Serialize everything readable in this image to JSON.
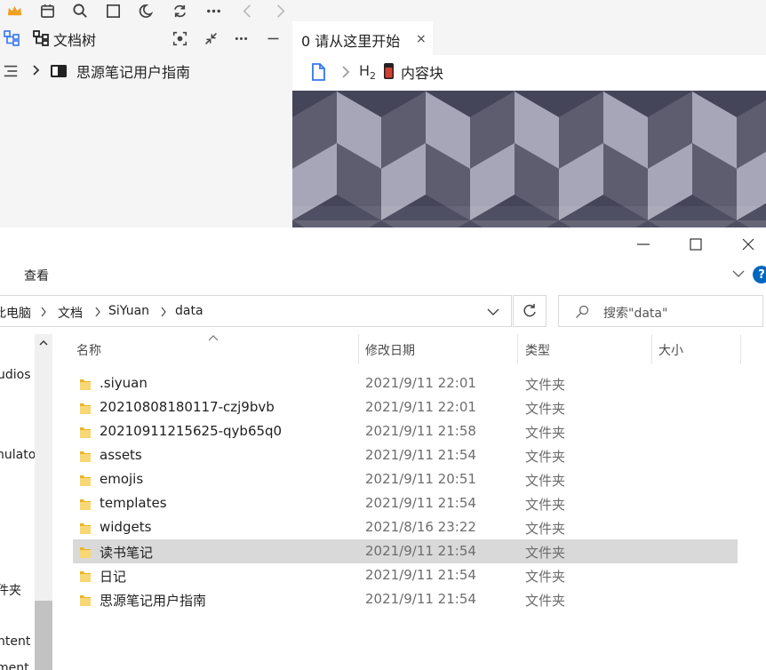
{
  "siyuan": {
    "toolbar_icons": [
      "crown-icon",
      "calendar-icon",
      "search-icon",
      "square-icon",
      "moon-icon",
      "sync-icon",
      "more-icon",
      "back-icon",
      "forward-icon"
    ],
    "filetree": {
      "title": "文档树",
      "notebook": "思源笔记用户指南"
    },
    "editor": {
      "tab_title": "0 请从这里开始",
      "tab_close": "×",
      "breadcrumb_heading": "H",
      "breadcrumb_heading_level": "2",
      "breadcrumb_block": "内容块"
    },
    "colors": {
      "accent": "#3575f0",
      "block_icon_red": "#d23f31"
    }
  },
  "explorer": {
    "ribbon_tab": "查看",
    "help": "?",
    "address": [
      "此电脑",
      "文档",
      "SiYuan",
      "data"
    ],
    "search_placeholder": "搜索\"data\"",
    "nav_items": [
      "udios",
      "nulator",
      "件夹",
      "ntent",
      "ment"
    ],
    "columns": {
      "name": "名称",
      "date": "修改日期",
      "type": "类型",
      "size": "大小"
    },
    "files": [
      {
        "name": ".siyuan",
        "date": "2021/9/11 22:01",
        "type": "文件夹"
      },
      {
        "name": "20210808180117-czj9bvb",
        "date": "2021/9/11 22:01",
        "type": "文件夹"
      },
      {
        "name": "20210911215625-qyb65q0",
        "date": "2021/9/11 21:58",
        "type": "文件夹"
      },
      {
        "name": "assets",
        "date": "2021/9/11 21:54",
        "type": "文件夹"
      },
      {
        "name": "emojis",
        "date": "2021/9/11 20:51",
        "type": "文件夹"
      },
      {
        "name": "templates",
        "date": "2021/9/11 21:54",
        "type": "文件夹"
      },
      {
        "name": "widgets",
        "date": "2021/8/16 23:22",
        "type": "文件夹"
      },
      {
        "name": "读书笔记",
        "date": "2021/9/11 21:54",
        "type": "文件夹",
        "selected": true
      },
      {
        "name": "日记",
        "date": "2021/9/11 21:54",
        "type": "文件夹"
      },
      {
        "name": "思源笔记用户指南",
        "date": "2021/9/11 21:54",
        "type": "文件夹"
      }
    ],
    "colors": {
      "selected_row": "#d9d9d9",
      "folder": "#f3c442",
      "help": "#0067c0"
    }
  }
}
